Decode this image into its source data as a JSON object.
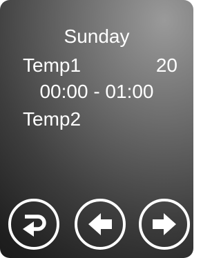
{
  "schedule": {
    "day": "Sunday",
    "entries": [
      {
        "label": "Temp1",
        "value": "20",
        "time": "00:00 - 01:00"
      },
      {
        "label": "Temp2"
      }
    ]
  },
  "buttons": {
    "back_icon": "return-arrow-icon",
    "prev_icon": "arrow-left-icon",
    "next_icon": "arrow-right-icon"
  },
  "colors": {
    "text": "#ffffff",
    "background_light": "#9a9a9a",
    "background_dark": "#151515"
  }
}
